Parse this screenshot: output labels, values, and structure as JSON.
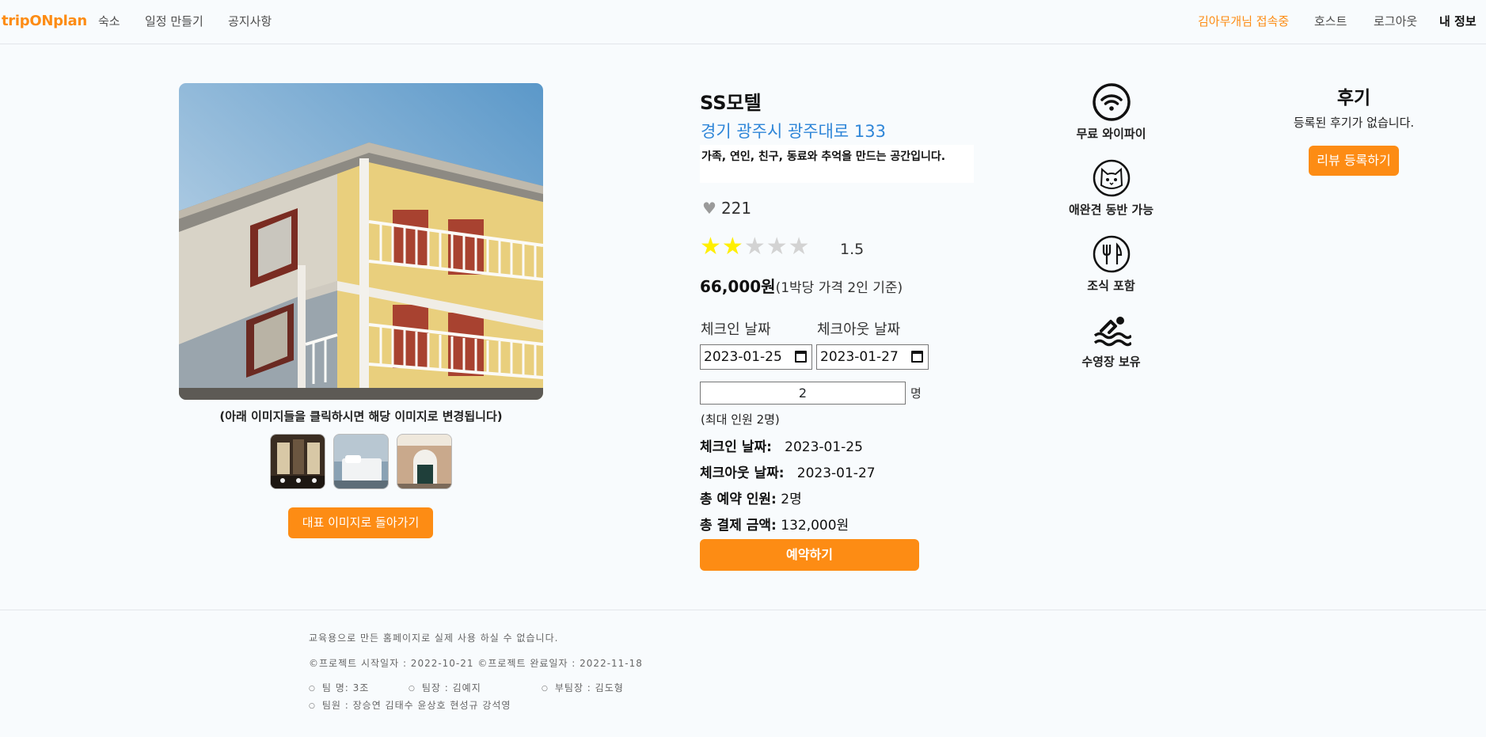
{
  "nav": {
    "brand": "tripONplan",
    "links": [
      "숙소",
      "일정 만들기",
      "공지사항"
    ],
    "user_status": "김아무개님 접속중",
    "host": "호스트",
    "logout": "로그아웃",
    "my_info": "내 정보"
  },
  "gallery": {
    "caption": "(아래 이미지들을 클릭하시면 해당 이미지로 변경됩니다)",
    "back_button": "대표 이미지로 돌아가기"
  },
  "hotel": {
    "name": "SS모텔",
    "address": "경기 광주시 광주대로 133",
    "description": "가족, 연인, 친구, 동료와 추억을 만드는 공간입니다.",
    "likes": "221",
    "rating_value": 1.5,
    "rating": "1.5",
    "price": "66,000원",
    "price_note": "(1박당 가격 2인 기준)"
  },
  "booking": {
    "checkin_label": "체크인 날짜",
    "checkout_label": "체크아웃 날짜",
    "checkin_value": "2023-01-25",
    "checkout_value": "2023-01-27",
    "guests_value": "2",
    "guests_unit": "명",
    "max_guests": "(최대 인원 2명)",
    "summary": {
      "checkin_label": "체크인 날짜:",
      "checkin_value": "2023-01-25",
      "checkout_label": "체크아웃 날짜:",
      "checkout_value": "2023-01-27",
      "guests_label": "총 예약 인원:",
      "guests_value": "2명",
      "total_label": "총 결제 금액:",
      "total_value": "132,000원"
    },
    "book_button": "예약하기"
  },
  "amenities": [
    {
      "icon": "wifi-icon",
      "label": "무료 와이파이"
    },
    {
      "icon": "cat-icon",
      "label": "애완견 동반 가능"
    },
    {
      "icon": "utensils-icon",
      "label": "조식 포함"
    },
    {
      "icon": "swimmer-icon",
      "label": "수영장 보유"
    }
  ],
  "reviews": {
    "title": "후기",
    "empty": "등록된 후기가 없습니다.",
    "button": "리뷰 등록하기"
  },
  "footer": {
    "notice": "교육용으로 만든 홈페이지로 실제 사용 하실 수 없습니다.",
    "dates": "©프로젝트 시작일자 : 2022-10-21 ©프로젝트 완료일자 : 2022-11-18",
    "team_name": "팀 명: 3조",
    "leader": "팀장 : 김예지",
    "sub_leader": "부팀장 : 김도형",
    "members": "팀원 : 장승연 김태수 윤상호 현성규 강석영"
  },
  "colors": {
    "accent": "#fd8c14",
    "link": "#2f86d8",
    "star": "#ffef00"
  }
}
